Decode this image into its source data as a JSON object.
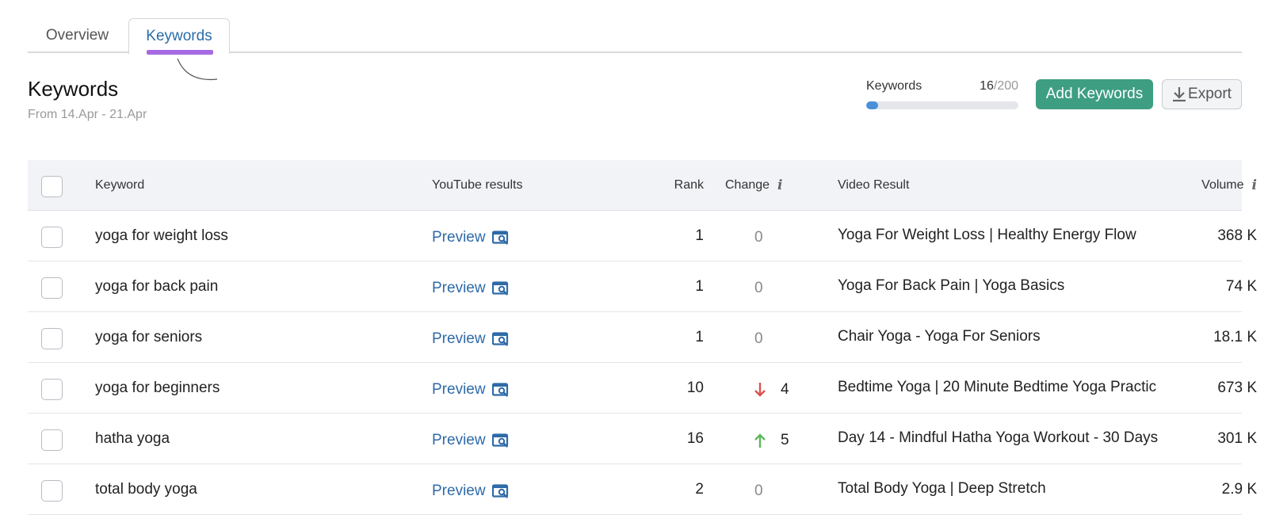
{
  "tabs": [
    {
      "label": "Overview",
      "active": false
    },
    {
      "label": "Keywords",
      "active": true
    }
  ],
  "header": {
    "title": "Keywords",
    "date_range": "From 14.Apr - 21.Apr"
  },
  "quota": {
    "label": "Keywords",
    "used": "16",
    "max": "/200",
    "fraction": 0.08
  },
  "actions": {
    "add_label": "Add Keywords",
    "export_label": "Export"
  },
  "table": {
    "columns": {
      "keyword": "Keyword",
      "youtube": "YouTube results",
      "rank": "Rank",
      "change": "Change",
      "video": "Video Result",
      "volume": "Volume"
    },
    "rows": [
      {
        "keyword": "yoga for weight loss",
        "preview": "Preview",
        "rank": "1",
        "change": "0",
        "trend": "none",
        "video": "Yoga For Weight Loss | Healthy Energy Flow",
        "volume": "368 K"
      },
      {
        "keyword": "yoga for back pain",
        "preview": "Preview",
        "rank": "1",
        "change": "0",
        "trend": "none",
        "video": "Yoga For Back Pain | Yoga Basics",
        "volume": "74 K"
      },
      {
        "keyword": "yoga for seniors",
        "preview": "Preview",
        "rank": "1",
        "change": "0",
        "trend": "none",
        "video": "Chair Yoga - Yoga For Seniors",
        "volume": "18.1 K"
      },
      {
        "keyword": "yoga for beginners",
        "preview": "Preview",
        "rank": "10",
        "change": "4",
        "trend": "down",
        "video": "Bedtime Yoga | 20 Minute Bedtime Yoga Practic",
        "volume": "673 K"
      },
      {
        "keyword": "hatha yoga",
        "preview": "Preview",
        "rank": "16",
        "change": "5",
        "trend": "up",
        "video": "Day 14 - Mindful Hatha Yoga Workout - 30 Days",
        "volume": "301 K"
      },
      {
        "keyword": "total body yoga",
        "preview": "Preview",
        "rank": "2",
        "change": "0",
        "trend": "none",
        "video": "Total Body Yoga | Deep Stretch",
        "volume": "2.9 K"
      }
    ]
  },
  "colors": {
    "accent": "#3e9e82",
    "link": "#2e6aa8",
    "tab_underline": "#a66be3",
    "down": "#d9534f",
    "up": "#5cb85c"
  }
}
